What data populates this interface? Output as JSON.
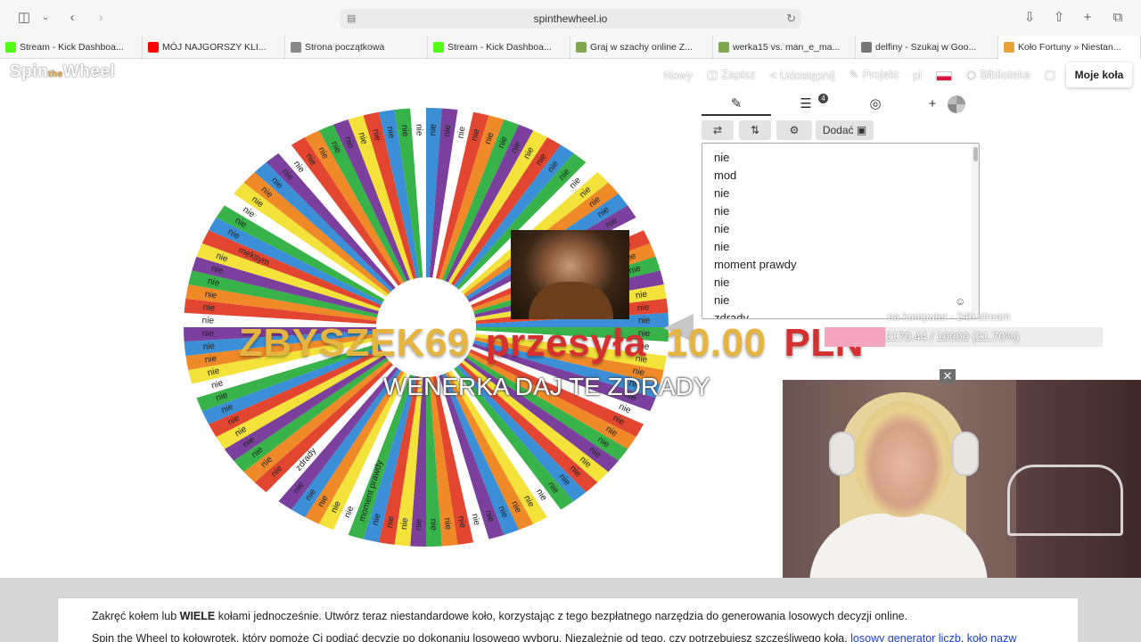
{
  "browser": {
    "url": "spinthewheel.io",
    "tabs": [
      {
        "label": "Stream - Kick Dashboa...",
        "icon": "kick-icon",
        "color": "#53fc18"
      },
      {
        "label": "MÓJ NAJGORSZY KLI...",
        "icon": "youtube-icon",
        "color": "#ff0000"
      },
      {
        "label": "Strona początkowa",
        "icon": "star-icon",
        "color": "#888888"
      },
      {
        "label": "Stream - Kick Dashboa...",
        "icon": "kick-icon",
        "color": "#53fc18"
      },
      {
        "label": "Graj w szachy online Z...",
        "icon": "pawn-icon",
        "color": "#7fa650"
      },
      {
        "label": "werka15 vs. man_e_ma...",
        "icon": "pawn-icon",
        "color": "#7fa650"
      },
      {
        "label": "delfiny - Szukaj w Goo...",
        "icon": "google-icon",
        "color": "#777777"
      },
      {
        "label": "Koło Fortuny » Niestan...",
        "icon": "wheel-icon",
        "color": "#e8a33a"
      }
    ]
  },
  "site": {
    "logo": "Spin",
    "logo_dot": "the",
    "logo_tail": "Wheel",
    "nav": {
      "new": "Nowy",
      "save": "Zapisz",
      "share": "Udostępnij",
      "project": "Projekt",
      "lang": "pl",
      "library": "Biblioteka",
      "my_wheels": "Moje koła"
    }
  },
  "wheel": {
    "colors": [
      "#3a8fd6",
      "#f2e23a",
      "#37b34a",
      "#e24630",
      "#7b3f9e",
      "#f08a28",
      "#ffffff"
    ],
    "slice_label": "nie",
    "special_labels": [
      "mod",
      "moment prawdy",
      "zdrady",
      "meksym"
    ]
  },
  "panel": {
    "badge": "4",
    "add_image": "Dodać",
    "entries": [
      "nie",
      "mod",
      "nie",
      "nie",
      "nie",
      "nie",
      "moment prawdy",
      "nie",
      "nie",
      "zdrady"
    ]
  },
  "alert": {
    "name": "ZBYSZEK69",
    "verb": "przesyła",
    "amount": "10.00",
    "currency": "PLN",
    "message": "WENERKA DAJ TE ZDRADY"
  },
  "goal": {
    "label": "na komputer - 24h stream",
    "progress_text": "2170.44 / 10000 (21.70%)",
    "fraction": 0.217
  },
  "footer": {
    "line1_a": "Zakręć kołem lub ",
    "line1_b": "WIELE",
    "line1_c": " kołami jednocześnie. Utwórz teraz niestandardowe koło, korzystając z tego bezpłatnego narzędzia do generowania losowych decyzji online.",
    "line2": "Spin the Wheel to kołowrotek, który pomoże Ci podjąć decyzję po dokonaniu losowego wyboru. Niezależnie od tego, czy potrzebujesz szczęśliwego koła, ",
    "link1": "losowy generator liczb",
    "sep": ", ",
    "link2": "koło nazw"
  }
}
